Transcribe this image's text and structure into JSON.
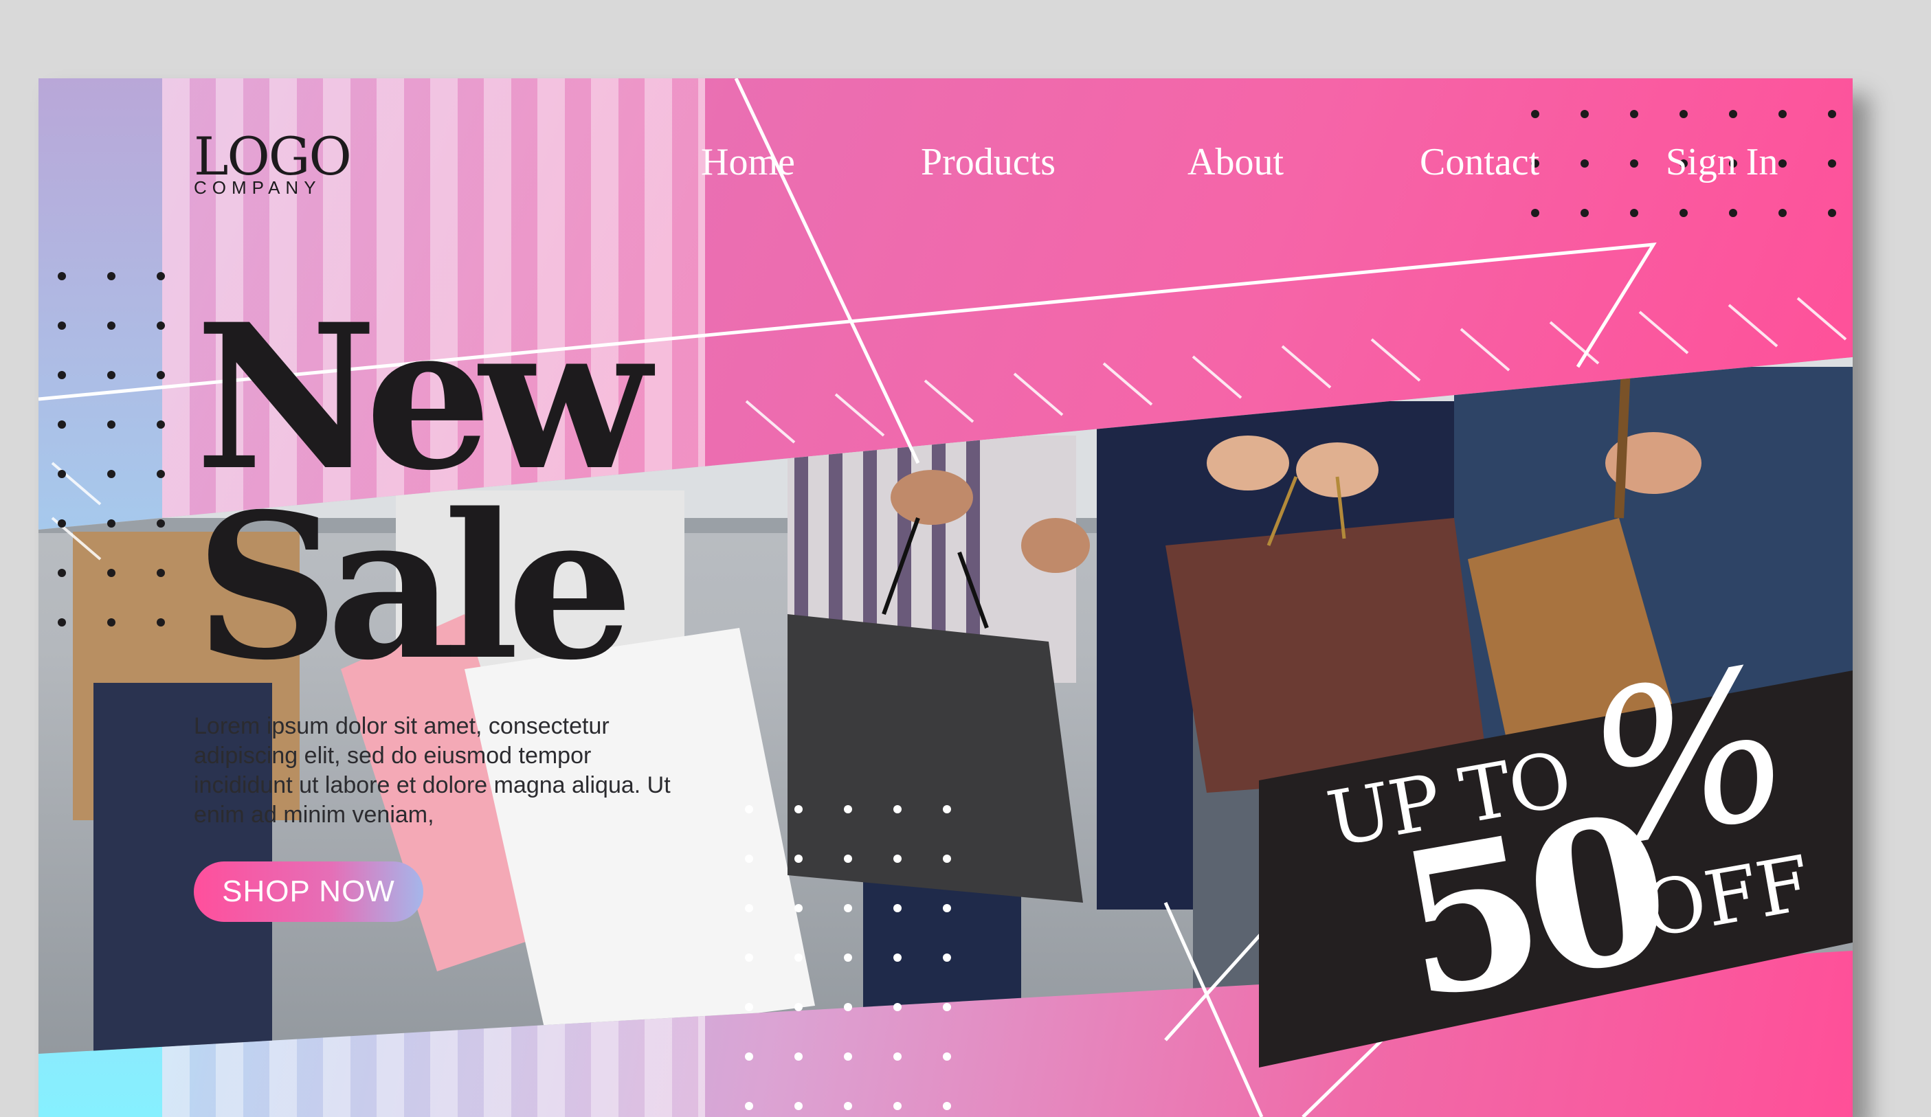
{
  "header": {
    "logo": {
      "main": "LOGO",
      "sub": "COMPANY"
    },
    "nav": [
      {
        "label": "Home"
      },
      {
        "label": "Products"
      },
      {
        "label": "About"
      },
      {
        "label": "Contact"
      },
      {
        "label": "Sign In"
      }
    ]
  },
  "hero": {
    "headline_line1": "New",
    "headline_line2": "Sale",
    "body": "Lorem ipsum dolor sit amet, consectetur adipiscing elit, sed do eiusmod tempor incididunt ut labore et dolore magna aliqua. Ut enim ad minim veniam,",
    "cta_label": "SHOP NOW",
    "photo_subject": "group-holding-shopping-bags"
  },
  "promo": {
    "line1": "UP TO",
    "percent_sign": "%",
    "amount": "50",
    "suffix": "OFF"
  },
  "colors": {
    "pink": "#ff4f98",
    "cyan": "#86f0ff",
    "dark": "#231f20",
    "text": "#ffffff"
  }
}
